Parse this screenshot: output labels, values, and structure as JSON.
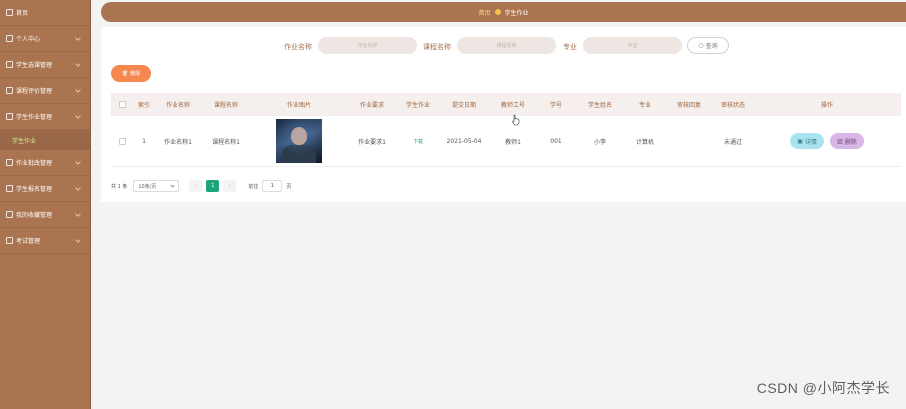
{
  "sidebar": {
    "items": [
      {
        "label": "首页",
        "icon": "home-icon"
      },
      {
        "label": "个人中心",
        "icon": "user-icon"
      },
      {
        "label": "学生选课管理",
        "icon": "grid-icon"
      },
      {
        "label": "课程评价管理",
        "icon": "grid-icon"
      },
      {
        "label": "学生作业管理",
        "icon": "grid-icon"
      },
      {
        "label": "作业批改管理",
        "icon": "grid-icon"
      },
      {
        "label": "学生报名管理",
        "icon": "grid-icon"
      },
      {
        "label": "我的收藏管理",
        "icon": "grid-icon"
      },
      {
        "label": "考试管理",
        "icon": "grid-icon"
      }
    ],
    "active_sub": "学生作业"
  },
  "topbar": {
    "home": "首页",
    "current": "学生作业"
  },
  "search": {
    "label1": "作业名称",
    "placeholder1": "作业名称",
    "label2": "课程名称",
    "placeholder2": "课程名称",
    "label3": "专业",
    "placeholder3": "专业",
    "query": "查询"
  },
  "toolbar": {
    "delete": "删除"
  },
  "table": {
    "headers": [
      "索引",
      "作业名称",
      "课程名称",
      "作业图片",
      "作业要求",
      "学生作业",
      "提交日期",
      "教师工号",
      "学号",
      "学生姓名",
      "专业",
      "审核回复",
      "审核状态",
      "操作"
    ],
    "row": {
      "index": "1",
      "hw_name": "作业名称1",
      "course": "课程名称1",
      "requirement": "作业要求1",
      "student_hw": "下载",
      "date": "2021-05-04",
      "teacher_id": "教师1",
      "student_id": "001",
      "student_name": "小李",
      "major": "计算机",
      "reply": "",
      "status": "未通过",
      "op_detail": "详情",
      "op_delete": "删除"
    }
  },
  "pager": {
    "total": "共 1 条",
    "size": "10条/页",
    "current": "1",
    "goto": "前往",
    "goto_value": "1",
    "page": "页"
  },
  "watermark": "CSDN @小阿杰学长",
  "colors": {
    "primary": "#a9744f",
    "accent": "#f5874f",
    "page_active": "#1aa57c"
  }
}
